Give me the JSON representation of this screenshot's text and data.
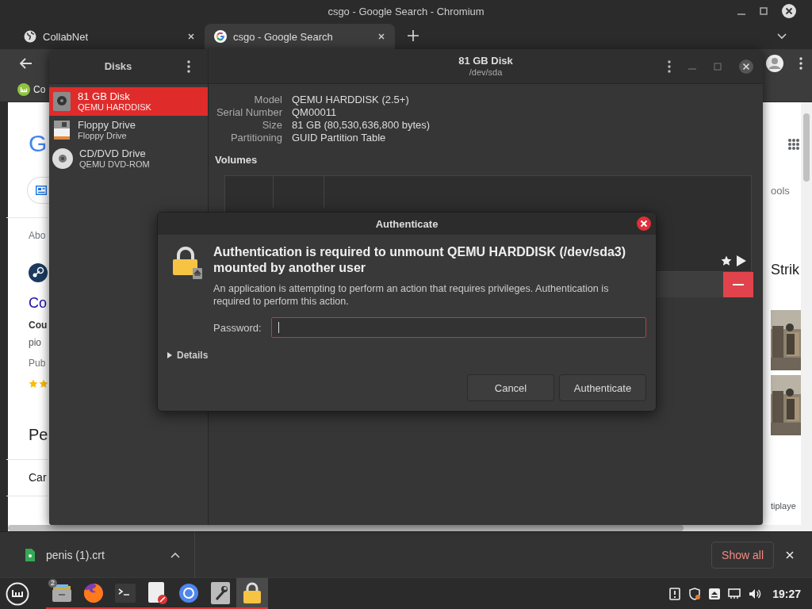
{
  "browser": {
    "title": "csgo - Google Search - Chromium",
    "tabs": [
      {
        "label": "CollabNet",
        "kind": "globe",
        "selected": false
      },
      {
        "label": "csgo - Google Search",
        "kind": "g_logo",
        "selected": true
      }
    ],
    "bookmark": "Co",
    "left_fragments": [
      {
        "kind": "logo",
        "text": "G"
      },
      {
        "kind": "chip"
      },
      {
        "kind": "note",
        "text": "Abo"
      },
      {
        "kind": "site_icon"
      },
      {
        "kind": "link",
        "text": "Co"
      },
      {
        "kind": "bold",
        "text": "Cou"
      },
      {
        "kind": "body",
        "text": "pio"
      },
      {
        "kind": "meta",
        "text": "Pub"
      },
      {
        "kind": "rating"
      },
      {
        "kind": "heading",
        "text": "Pe"
      },
      {
        "kind": "item",
        "text": "Car"
      }
    ],
    "right_fragments": [
      {
        "kind": "apps_icon"
      },
      {
        "kind": "note",
        "text": "ools"
      },
      {
        "kind": "title",
        "text": "Strik"
      },
      {
        "kind": "picture"
      },
      {
        "kind": "picture"
      },
      {
        "kind": "footer",
        "text": "tiplaye"
      }
    ],
    "download": {
      "filename": "penis (1).crt",
      "show_all": "Show all"
    }
  },
  "disks": {
    "sidebar_title": "Disks",
    "title": "81 GB Disk",
    "subtitle": "/dev/sda",
    "drives": [
      {
        "name": "81 GB Disk",
        "subtitle": "QEMU HARDDISK",
        "kind": "harddisk",
        "selected": true
      },
      {
        "name": "Floppy Drive",
        "subtitle": "Floppy Drive",
        "kind": "floppy",
        "selected": false
      },
      {
        "name": "CD/DVD Drive",
        "subtitle": "QEMU DVD-ROM",
        "kind": "optical",
        "selected": false
      }
    ],
    "properties": [
      {
        "label": "Model",
        "value": "QEMU HARDDISK (2.5+)"
      },
      {
        "label": "Serial Number",
        "value": "QM00011"
      },
      {
        "label": "Size",
        "value": "81 GB (80,530,636,800 bytes)"
      },
      {
        "label": "Partitioning",
        "value": "GUID Partition Table"
      }
    ],
    "volumes_heading": "Volumes"
  },
  "dialog": {
    "title": "Authenticate",
    "heading": "Authentication is required to unmount QEMU HARDDISK (/dev/sda3) mounted by another user",
    "message": "An application is attempting to perform an action that requires privileges. Authentication is required to perform this action.",
    "password_label": "Password:",
    "details": "Details",
    "expanded": false,
    "buttons": [
      "Cancel",
      "Authenticate"
    ]
  },
  "taskbar": {
    "apps": [
      {
        "kind": "files",
        "badge": "2",
        "active": false
      },
      {
        "kind": "firefox",
        "active": false
      },
      {
        "kind": "terminal",
        "active": false
      },
      {
        "kind": "editor",
        "active": false
      },
      {
        "kind": "chromium",
        "active": false
      },
      {
        "kind": "tools",
        "active": false
      },
      {
        "kind": "lock",
        "active": true
      }
    ],
    "clock": "19:27"
  }
}
